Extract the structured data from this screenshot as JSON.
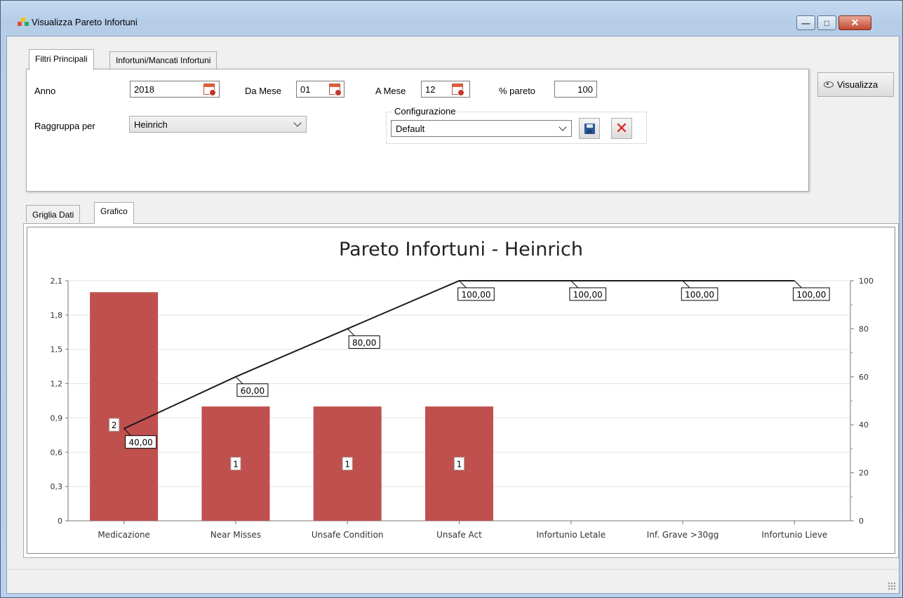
{
  "window": {
    "title": "Visualizza Pareto Infortuni",
    "controls": {
      "minimize": "—",
      "maximize": "□",
      "close": "✕"
    }
  },
  "top_tabs": [
    {
      "label": "Filtri Principali",
      "active": true
    },
    {
      "label": "Infortuni/Mancati Infortuni",
      "active": false
    }
  ],
  "filters": {
    "anno_label": "Anno",
    "anno_value": "2018",
    "da_mese_label": "Da Mese",
    "da_mese_value": "01",
    "a_mese_label": "A Mese",
    "a_mese_value": "12",
    "pareto_label": "% pareto",
    "pareto_value": "100",
    "raggruppa_label": "Raggruppa per",
    "raggruppa_value": "Heinrich",
    "configurazione_label": "Configurazione",
    "configurazione_value": "Default"
  },
  "actions": {
    "visualizza_label": "Visualizza"
  },
  "bottom_tabs": [
    {
      "label": "Griglia Dati",
      "active": false
    },
    {
      "label": "Grafico",
      "active": true
    }
  ],
  "colors": {
    "bar": "#c0504d",
    "line": "#1a1a1a",
    "grid": "#e3e3e3"
  },
  "chart_data": {
    "type": "bar",
    "title": "Pareto Infortuni - Heinrich",
    "categories": [
      "Medicazione",
      "Near Misses",
      "Unsafe Condition",
      "Unsafe Act",
      "Infortunio Letale",
      "Inf. Grave >30gg",
      "Infortunio Lieve"
    ],
    "series": [
      {
        "values": [
          2,
          1,
          1,
          1,
          0,
          0,
          0
        ],
        "axis": "left",
        "type": "bar",
        "labels": [
          "2",
          "1",
          "1",
          "1",
          "",
          "",
          ""
        ]
      },
      {
        "values": [
          40,
          60,
          80,
          100,
          100,
          100,
          100
        ],
        "axis": "right",
        "type": "line",
        "labels": [
          "40,00",
          "60,00",
          "80,00",
          "100,00",
          "100,00",
          "100,00",
          "100,00"
        ]
      }
    ],
    "ylim_left": [
      0,
      2.1
    ],
    "yticks_left": [
      "0",
      "0,3",
      "0,6",
      "0,9",
      "1,2",
      "1,5",
      "1,8",
      "2,1"
    ],
    "ylim_right": [
      0,
      100
    ],
    "yticks_right": [
      "0",
      "20",
      "40",
      "60",
      "80",
      "100"
    ],
    "grid": true
  }
}
